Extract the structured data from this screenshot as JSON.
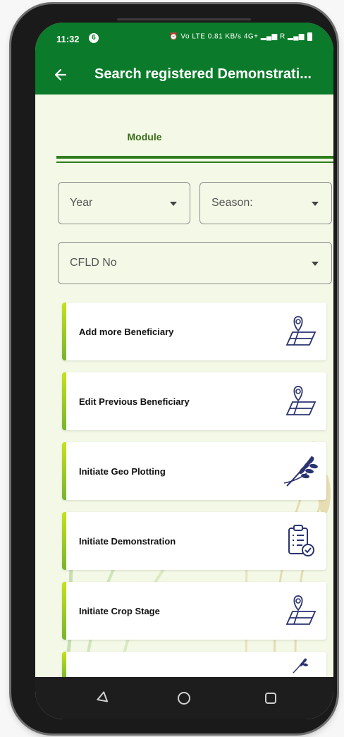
{
  "status_bar": {
    "time": "11:32",
    "notification": "6",
    "indicators": "⏰ Vo LTE 0.81 KB/s 4G+ ▂▄▆ R ▂▄▆"
  },
  "app_bar": {
    "back_icon": "arrow-left-icon",
    "title": "Search registered Demonstrati..."
  },
  "tabs": {
    "module": "Module"
  },
  "filters": {
    "year": "Year",
    "season": "Season:",
    "cfld_no": "CFLD No"
  },
  "menu": [
    {
      "label": "Add more Beneficiary",
      "icon": "map-pin-icon"
    },
    {
      "label": "Edit Previous Beneficiary",
      "icon": "map-pin-icon"
    },
    {
      "label": "Initiate Geo Plotting",
      "icon": "wheat-icon"
    },
    {
      "label": "Initiate Demonstration",
      "icon": "clipboard-check-icon"
    },
    {
      "label": "Initiate Crop Stage",
      "icon": "map-pin-icon"
    }
  ],
  "nav": [
    "back-triangle-icon",
    "home-circle-icon",
    "recents-square-icon"
  ],
  "colors": {
    "primary_green": "#0b7a2a",
    "tab_text_green": "#3a6b16",
    "card_accent": "#c5e21a",
    "icon_navy": "#2b3470",
    "screen_bg": "#f3f9e6"
  }
}
